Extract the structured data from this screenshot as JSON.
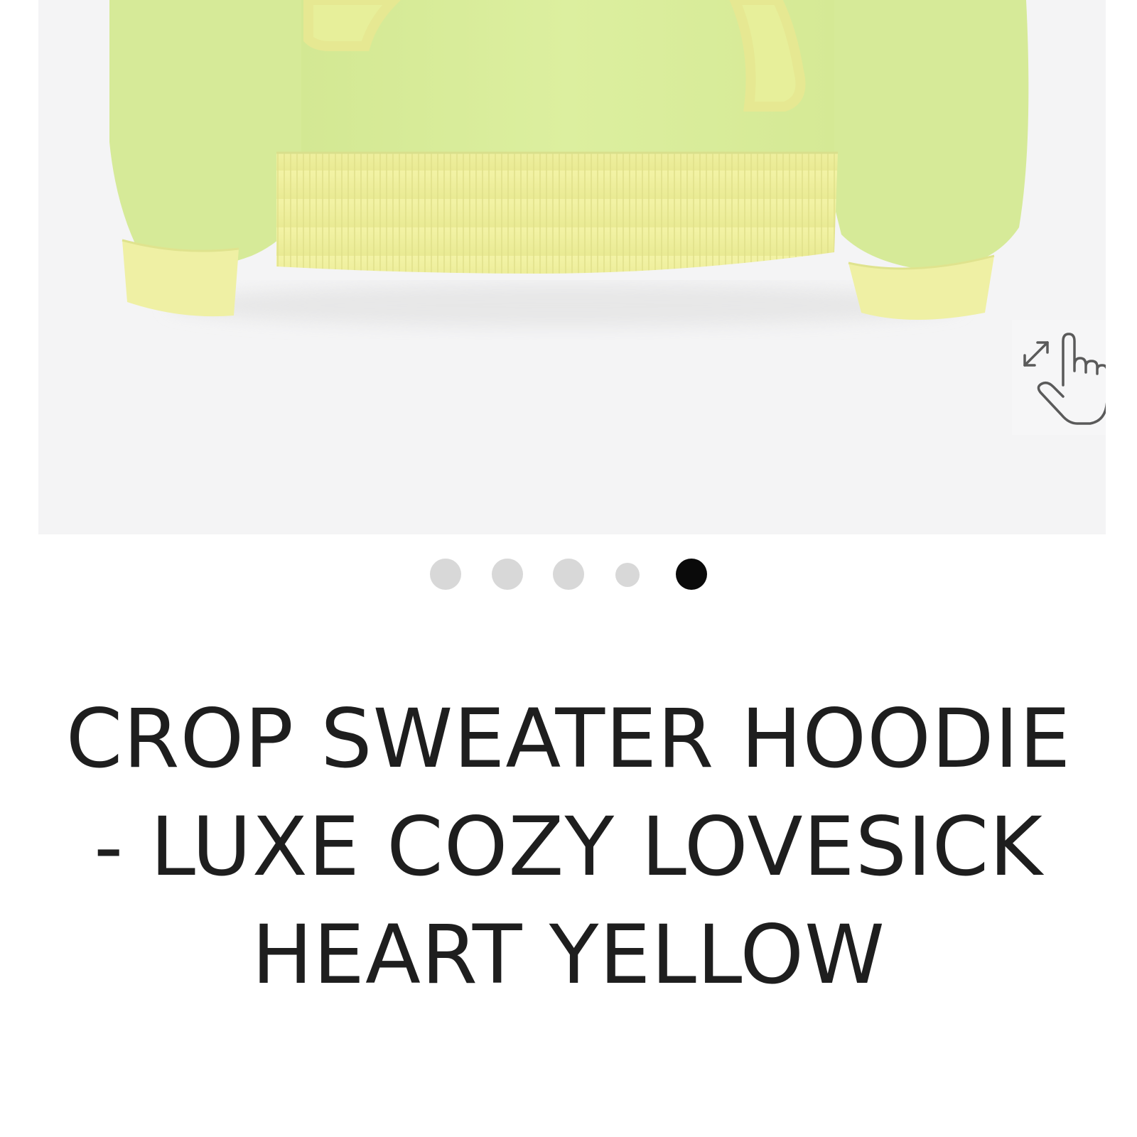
{
  "product": {
    "image": {
      "description_icon": "product-photo",
      "colors": {
        "panel_background": "#f4f4f5",
        "sweater_body": "#d7ea96",
        "sweater_rib": "#eff0a0"
      }
    },
    "zoom_hint_icon": "pinch-zoom-hand-icon",
    "carousel": {
      "total": 5,
      "active_index": 4
    },
    "title": "CROP SWEATER HOODIE - LUXE COZY LOVESICK HEART YELLOW"
  }
}
